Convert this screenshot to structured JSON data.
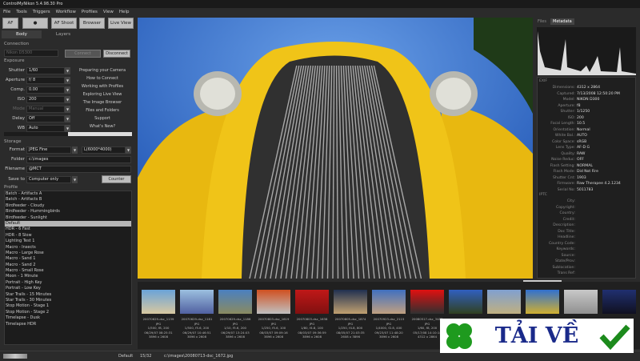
{
  "app": {
    "title": "ControlMyNikon 5.4.98.30 Pro"
  },
  "menu": [
    "File",
    "Tools",
    "Triggers",
    "Workflow",
    "Profiles",
    "View",
    "Help"
  ],
  "toolbar": {
    "af": "AF",
    "af_shoot": "AF Shoot",
    "browser": "Browser",
    "live_view": "Live View"
  },
  "left": {
    "tabs": [
      "Body",
      "Layers"
    ],
    "connection": {
      "title": "Connection",
      "camera": "Nikon D5300",
      "connect": "Connect",
      "disconnect": "Disconnect"
    },
    "exposure": {
      "title": "Exposure",
      "fields": [
        {
          "label": "Shutter",
          "value": "1/60"
        },
        {
          "label": "Aperture",
          "value": "f/ 8"
        },
        {
          "label": "Comp.",
          "value": "0.00"
        },
        {
          "label": "ISO",
          "value": "200"
        },
        {
          "label": "Mode",
          "value": "Manual"
        },
        {
          "label": "Delay",
          "value": "Off"
        },
        {
          "label": "WB",
          "value": "Auto"
        }
      ]
    },
    "help_links": [
      "Preparing your Camera",
      "How to Connect",
      "Working with Profiles",
      "Exploring Live View",
      "The Image Browser",
      "Files and Folders",
      "Support",
      "What's New?"
    ],
    "storage": {
      "title": "Storage",
      "format_label": "Format",
      "format": "JPEG Fine",
      "size": "L(6000*4000)",
      "folder_label": "Folder",
      "folder": "c:\\images",
      "filename_label": "Filename",
      "filename": "@MCT",
      "saveto_label": "Save to",
      "saveto": "Computer only",
      "counter": "Counter"
    },
    "profile": {
      "title": "Profile",
      "selected": "Default",
      "items": [
        "Batch - Artifacts A",
        "Batch - Artifacts B",
        "Birdfeeder - Cloudy",
        "Birdfeeder - Hummingbirds",
        "Birdfeeder - Sunlight",
        "Default",
        "HDR - 6 Fast",
        "HDR - 8 Slow",
        "Lighting Test 1",
        "Macro - Insects",
        "Macro - Large Rose",
        "Macro - Sand 1",
        "Macro - Sand 2",
        "Macro - Small Rose",
        "Moon - 1 Minute",
        "Portrait - High Key",
        "Portrait - Low Key",
        "Star Trails - 15 Minutes",
        "Star Trails - 30 Minutes",
        "Stop Motion - Stage 1",
        "Stop Motion - Stage 2",
        "Timelapse - Dusk",
        "Timelapse HDR"
      ]
    }
  },
  "right": {
    "tabs": [
      "Files",
      "Metadata"
    ],
    "exif_title": "EXIF",
    "exif": [
      [
        "Dimensions:",
        "4312 x 2864"
      ],
      [
        "Captured:",
        "7/13/2008 12:50:20 PM"
      ],
      [
        "Model:",
        "NIKON D300"
      ],
      [
        "Aperture:",
        "f8"
      ],
      [
        "Shutter:",
        "1/1250"
      ],
      [
        "ISO:",
        "200"
      ],
      [
        "Focal Length:",
        "10.5"
      ],
      [
        "Orientation:",
        "Normal"
      ],
      [
        "White Bal.:",
        "AUTO"
      ],
      [
        "Color Space:",
        "sRGB"
      ],
      [
        "Lens Type:",
        "AF-D G"
      ],
      [
        "Quality:",
        "RAW"
      ],
      [
        "Noise Reduc:",
        "OFF"
      ],
      [
        "Flash Setting:",
        "NORMAL"
      ],
      [
        "Flash Mode:",
        "Did Not Fire"
      ],
      [
        "Shutter Cnt:",
        "1903"
      ],
      [
        "Firmware:",
        "Raw Therapee 4.2.1234"
      ],
      [
        "Serial No:",
        "5011783"
      ]
    ],
    "iptc_title": "IPTC",
    "iptc": [
      "City:",
      "Copyright:",
      "Country:",
      "Credit:",
      "Description:",
      "Doc Title:",
      "Headline:",
      "Country Code:",
      "Keywords:",
      "Source:",
      "State/Prov:",
      "Sublocation:",
      "Trans Ref:"
    ]
  },
  "film": [
    {
      "name": "20070629-dsc_1139",
      "ext": "JPG",
      "exp": "1/500, f8, 200",
      "date": "06/29/07 08:25:31",
      "size": "3896 x 2608",
      "c1": "#6aa3d8",
      "c2": "#d8c8a0"
    },
    {
      "name": "20070629-dsc_1181",
      "ext": "JPG",
      "exp": "1/500, f5.6, 200",
      "date": "06/29/07 10:46:51",
      "size": "3896 x 2608",
      "c1": "#9cc0e0",
      "c2": "#5060a0"
    },
    {
      "name": "20070629-dsc_1186",
      "ext": "JPG",
      "exp": "1/10, f5.6, 200",
      "date": "06/29/07 13:24:03",
      "size": "3896 x 2608",
      "c1": "#4a80c0",
      "c2": "#8a8a60"
    },
    {
      "name": "20070803-dsc_1619",
      "ext": "JPG",
      "exp": "1/250, f5.6, 100",
      "date": "08/03/07 09:09:16",
      "size": "3896 x 2608",
      "c1": "#d05020",
      "c2": "#c0c0c0"
    },
    {
      "name": "20070803-dsc_1638",
      "ext": "JPG",
      "exp": "1/80, f4.8, 100",
      "date": "08/03/07 09:36:59",
      "size": "3896 x 2608",
      "c1": "#c01818",
      "c2": "#801010"
    },
    {
      "name": "20070805-dsc_1874",
      "ext": "JPG",
      "exp": "1/250, f4.8, 800",
      "date": "08/05/07 21:03:35",
      "size": "2608 x 3896",
      "c1": "#203050",
      "c2": "#c0a070"
    },
    {
      "name": "20070923-dsc_2115",
      "ext": "JPG",
      "exp": "1/4000, f2.8, 400",
      "date": "09/23/07 11:48:20",
      "size": "3896 x 2608",
      "c1": "#4070c0",
      "c2": "#c0a080"
    },
    {
      "name": "20080517-dsc_3488",
      "ext": "JPG",
      "exp": "1/60, f8, 200",
      "date": "05/17/08 14:10:14",
      "size": "4312 x 2864",
      "c1": "#e01010",
      "c2": "#303030"
    },
    {
      "name": "",
      "ext": "",
      "exp": "",
      "date": "",
      "size": "",
      "c1": "#3060c0",
      "c2": "#304020"
    },
    {
      "name": "",
      "ext": "",
      "exp": "",
      "date": "",
      "size": "",
      "c1": "#80a0d0",
      "c2": "#c0b080"
    },
    {
      "name": "",
      "ext": "",
      "exp": "",
      "date": "",
      "size": "",
      "c1": "#3070d0",
      "c2": "#d0b030"
    },
    {
      "name": "",
      "ext": "",
      "exp": "",
      "date": "",
      "size": "",
      "c1": "#c8c8c8",
      "c2": "#909090"
    },
    {
      "name": "",
      "ext": "",
      "exp": "",
      "date": "",
      "size": "",
      "c1": "#203070",
      "c2": "#101020"
    }
  ],
  "status": {
    "profile": "Default",
    "count": "15/32",
    "path": "c:\\images\\20080713-dsc_1672.jpg"
  },
  "watermark": {
    "text": "TẢI VỀ"
  },
  "colors": {
    "accent": "#b5b5b5",
    "sky": "#1f5fc8",
    "car": "#f0c010"
  }
}
